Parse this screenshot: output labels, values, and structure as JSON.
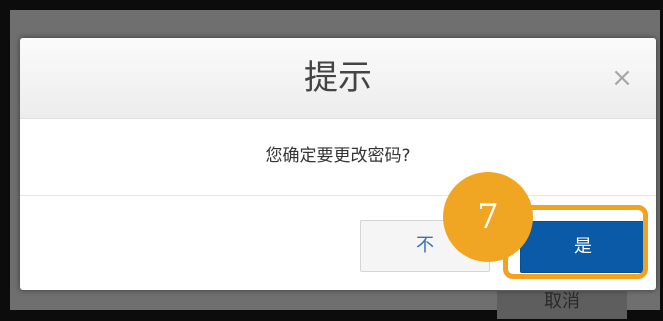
{
  "dialog": {
    "title": "提示",
    "message": "您确定要更改密码?",
    "close_glyph": "×",
    "no_label": "不",
    "yes_label": "是"
  },
  "background": {
    "button_label": "取消"
  },
  "annotation": {
    "step_number": "7",
    "color": "#f2a21e"
  },
  "colors": {
    "primary": "#0b5aa7",
    "secondary_text": "#3d6fb3"
  }
}
